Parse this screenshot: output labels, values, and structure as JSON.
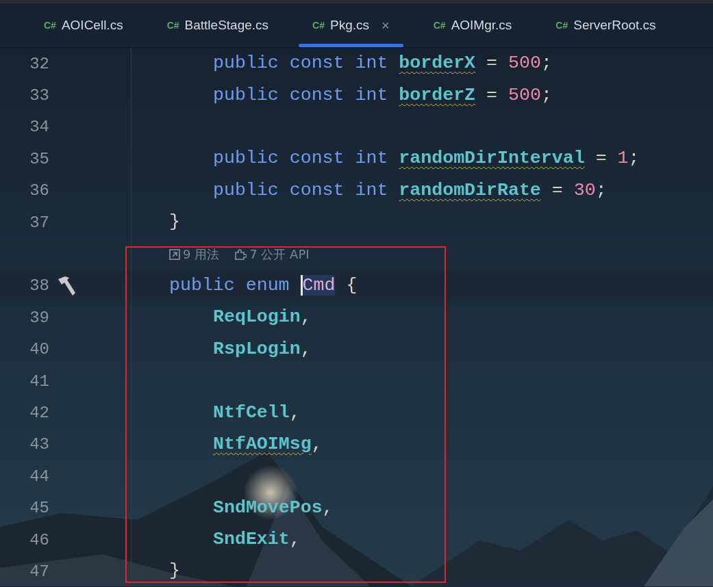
{
  "tabs": [
    {
      "icon_text": "C#",
      "label": "AOICell.cs",
      "selected": false
    },
    {
      "icon_text": "C#",
      "label": "BattleStage.cs",
      "selected": false
    },
    {
      "icon_text": "C#",
      "label": "Pkg.cs",
      "selected": true,
      "close": "×"
    },
    {
      "icon_text": "C#",
      "label": "AOIMgr.cs",
      "selected": false
    },
    {
      "icon_text": "C#",
      "label": "ServerRoot.cs",
      "selected": false
    }
  ],
  "editor": {
    "lines": [
      {
        "kind": "block",
        "children": [
          {
            "kind": "code",
            "number": "32",
            "tokens": [
              {
                "kind": "keyword",
                "text": "public"
              },
              {
                "kind": "keyword",
                "text": "const"
              },
              {
                "kind": "keyword",
                "text": "int"
              },
              {
                "kind": "field",
                "text": "borderX",
                "warning": true
              },
              {
                "kind": "operator",
                "text": "="
              },
              {
                "kind": "number",
                "text": "500"
              },
              {
                "kind": "separator",
                "text": ";"
              }
            ]
          },
          {
            "kind": "code",
            "number": "33",
            "tokens": [
              {
                "kind": "keyword",
                "text": "public"
              },
              {
                "kind": "keyword",
                "text": "const"
              },
              {
                "kind": "keyword",
                "text": "int"
              },
              {
                "kind": "field",
                "text": "borderZ",
                "warning": true
              },
              {
                "kind": "operator",
                "text": "="
              },
              {
                "kind": "number",
                "text": "500"
              },
              {
                "kind": "separator",
                "text": ";"
              }
            ]
          },
          {
            "kind": "code",
            "number": "34"
          },
          {
            "kind": "code",
            "number": "35",
            "tokens": [
              {
                "kind": "keyword",
                "text": "public"
              },
              {
                "kind": "keyword",
                "text": "const"
              },
              {
                "kind": "keyword",
                "text": "int"
              },
              {
                "kind": "field",
                "text": "randomDirInterval",
                "warning": true
              },
              {
                "kind": "operator",
                "text": "="
              },
              {
                "kind": "number",
                "text": "1"
              },
              {
                "kind": "separator",
                "text": ";"
              }
            ]
          },
          {
            "kind": "code",
            "number": "36",
            "tokens": [
              {
                "kind": "keyword",
                "text": "public"
              },
              {
                "kind": "keyword",
                "text": "const"
              },
              {
                "kind": "keyword",
                "text": "int"
              },
              {
                "kind": "field",
                "text": "randomDirRate",
                "warning": true
              },
              {
                "kind": "operator",
                "text": "="
              },
              {
                "kind": "number",
                "text": "30"
              },
              {
                "kind": "separator",
                "text": ";"
              }
            ]
          }
        ]
      },
      {
        "kind": "code",
        "number": "37",
        "tokens": [
          {
            "kind": "operator",
            "text": "}"
          }
        ]
      },
      {
        "kind": "hint",
        "usages": "9 用法",
        "api": "7 公开 API"
      },
      {
        "kind": "code",
        "number": "38",
        "current": true,
        "tokens": [
          {
            "kind": "keyword",
            "text": "public"
          },
          {
            "kind": "keyword",
            "text": "enum"
          },
          {
            "kind": "type",
            "text": "Cmd",
            "caret": true,
            "highlighted": true
          },
          {
            "kind": "operator",
            "text": "{"
          }
        ],
        "children": [
          {
            "kind": "code",
            "number": "39",
            "tokens": [
              {
                "kind": "member",
                "text": "ReqLogin"
              },
              {
                "kind": "separator",
                "text": ","
              }
            ]
          },
          {
            "kind": "code",
            "number": "40",
            "tokens": [
              {
                "kind": "member",
                "text": "RspLogin"
              },
              {
                "kind": "separator",
                "text": ","
              }
            ]
          },
          {
            "kind": "code",
            "number": "41"
          },
          {
            "kind": "code",
            "number": "42",
            "tokens": [
              {
                "kind": "member",
                "text": "NtfCell"
              },
              {
                "kind": "separator",
                "text": ","
              }
            ]
          },
          {
            "kind": "code",
            "number": "43",
            "tokens": [
              {
                "kind": "member",
                "text": "NtfAOIMsg",
                "warning": true
              },
              {
                "kind": "separator",
                "text": ","
              }
            ]
          },
          {
            "kind": "code",
            "number": "44"
          },
          {
            "kind": "code",
            "number": "45",
            "tokens": [
              {
                "kind": "member",
                "text": "SndMovePos"
              },
              {
                "kind": "separator",
                "text": ","
              }
            ]
          },
          {
            "kind": "code",
            "number": "46",
            "tokens": [
              {
                "kind": "member",
                "text": "SndExit"
              },
              {
                "kind": "separator",
                "text": ","
              }
            ]
          }
        ]
      },
      {
        "kind": "code",
        "number": "47",
        "tokens": [
          {
            "kind": "operator",
            "text": "}"
          }
        ]
      }
    ]
  }
}
